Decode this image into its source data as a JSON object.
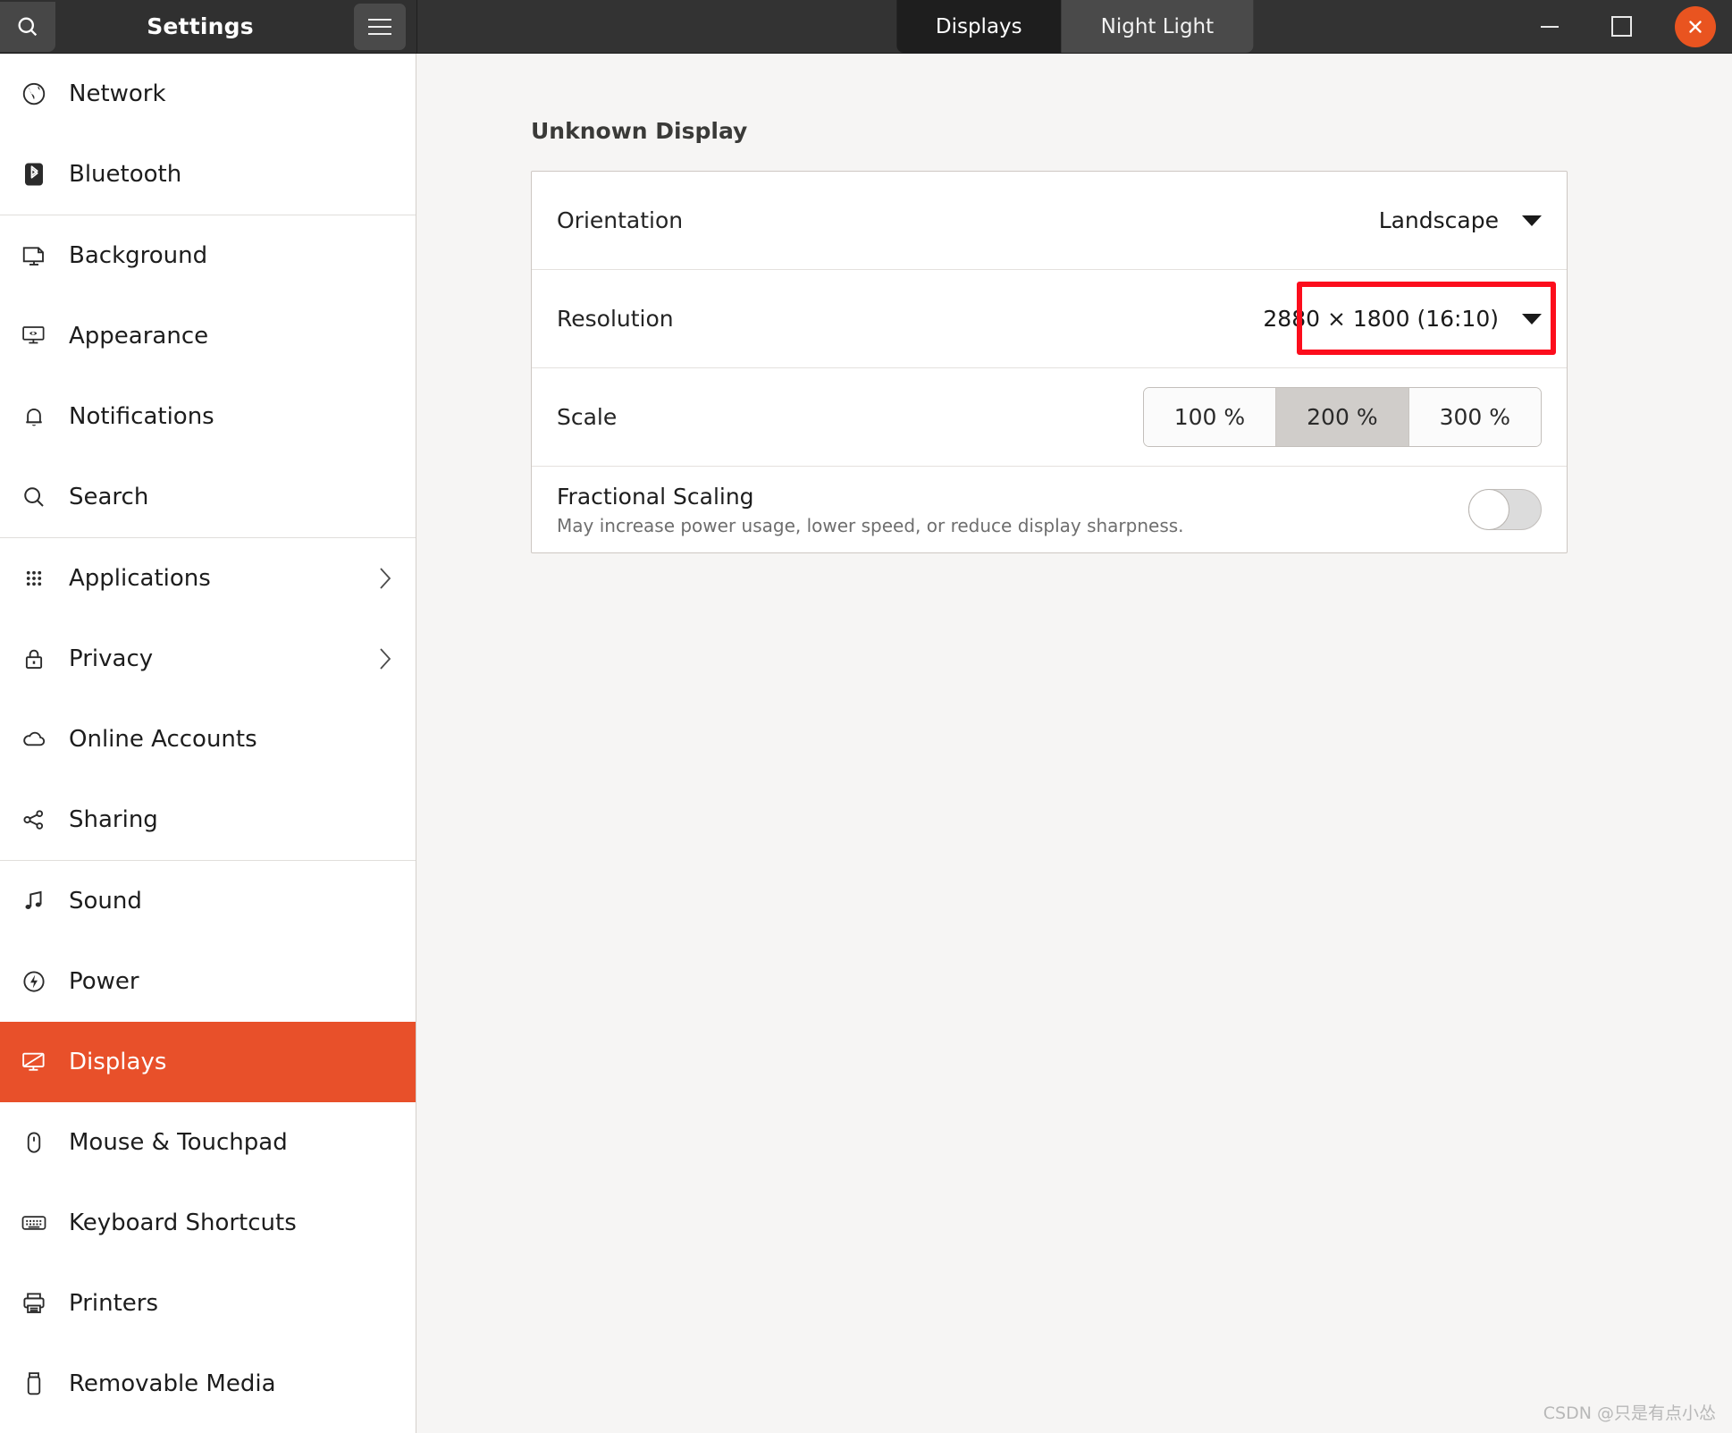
{
  "window": {
    "app_title": "Settings",
    "search_icon": "search-icon",
    "menu_icon": "hamburger-menu-icon",
    "controls": {
      "minimize": "minimize-icon",
      "maximize": "maximize-icon",
      "close": "close-icon"
    }
  },
  "tabs": [
    {
      "label": "Displays",
      "active": true
    },
    {
      "label": "Night Light",
      "active": false
    }
  ],
  "sidebar": {
    "groups": [
      {
        "items": [
          {
            "label": "Network",
            "icon": "globe-icon",
            "chevron": false,
            "selected": false
          },
          {
            "label": "Bluetooth",
            "icon": "bluetooth-icon",
            "chevron": false,
            "selected": false
          }
        ]
      },
      {
        "items": [
          {
            "label": "Background",
            "icon": "monitor-icon",
            "chevron": false,
            "selected": false
          },
          {
            "label": "Appearance",
            "icon": "appearance-icon",
            "chevron": false,
            "selected": false
          },
          {
            "label": "Notifications",
            "icon": "bell-icon",
            "chevron": false,
            "selected": false
          },
          {
            "label": "Search",
            "icon": "search-icon",
            "chevron": false,
            "selected": false
          }
        ]
      },
      {
        "items": [
          {
            "label": "Applications",
            "icon": "grid-dots-icon",
            "chevron": true,
            "selected": false
          },
          {
            "label": "Privacy",
            "icon": "lock-icon",
            "chevron": true,
            "selected": false
          },
          {
            "label": "Online Accounts",
            "icon": "cloud-icon",
            "chevron": false,
            "selected": false
          },
          {
            "label": "Sharing",
            "icon": "share-nodes-icon",
            "chevron": false,
            "selected": false
          }
        ]
      },
      {
        "items": [
          {
            "label": "Sound",
            "icon": "music-note-icon",
            "chevron": false,
            "selected": false
          },
          {
            "label": "Power",
            "icon": "power-bolt-icon",
            "chevron": false,
            "selected": false
          },
          {
            "label": "Displays",
            "icon": "display-icon",
            "chevron": false,
            "selected": true
          },
          {
            "label": "Mouse & Touchpad",
            "icon": "mouse-icon",
            "chevron": false,
            "selected": false
          },
          {
            "label": "Keyboard Shortcuts",
            "icon": "keyboard-icon",
            "chevron": false,
            "selected": false
          },
          {
            "label": "Printers",
            "icon": "printer-icon",
            "chevron": false,
            "selected": false
          },
          {
            "label": "Removable Media",
            "icon": "usb-drive-icon",
            "chevron": false,
            "selected": false
          }
        ]
      }
    ]
  },
  "main": {
    "panel_title": "Unknown Display",
    "orientation": {
      "label": "Orientation",
      "value": "Landscape"
    },
    "resolution": {
      "label": "Resolution",
      "value": "2880 × 1800 (16:10)",
      "highlight_color": "#fc0d1c",
      "highlighted": true
    },
    "scale": {
      "label": "Scale",
      "options": [
        "100 %",
        "200 %",
        "300 %"
      ],
      "selected": "200 %"
    },
    "fractional_scaling": {
      "label": "Fractional Scaling",
      "description": "May increase power usage, lower speed, or reduce display sharpness.",
      "enabled": false
    }
  },
  "watermark": "CSDN @只是有点小怂",
  "colors": {
    "accent": "#e8502a",
    "close_button": "#e95420",
    "titlebar": "#303030",
    "panel_bg": "#f6f5f4"
  }
}
